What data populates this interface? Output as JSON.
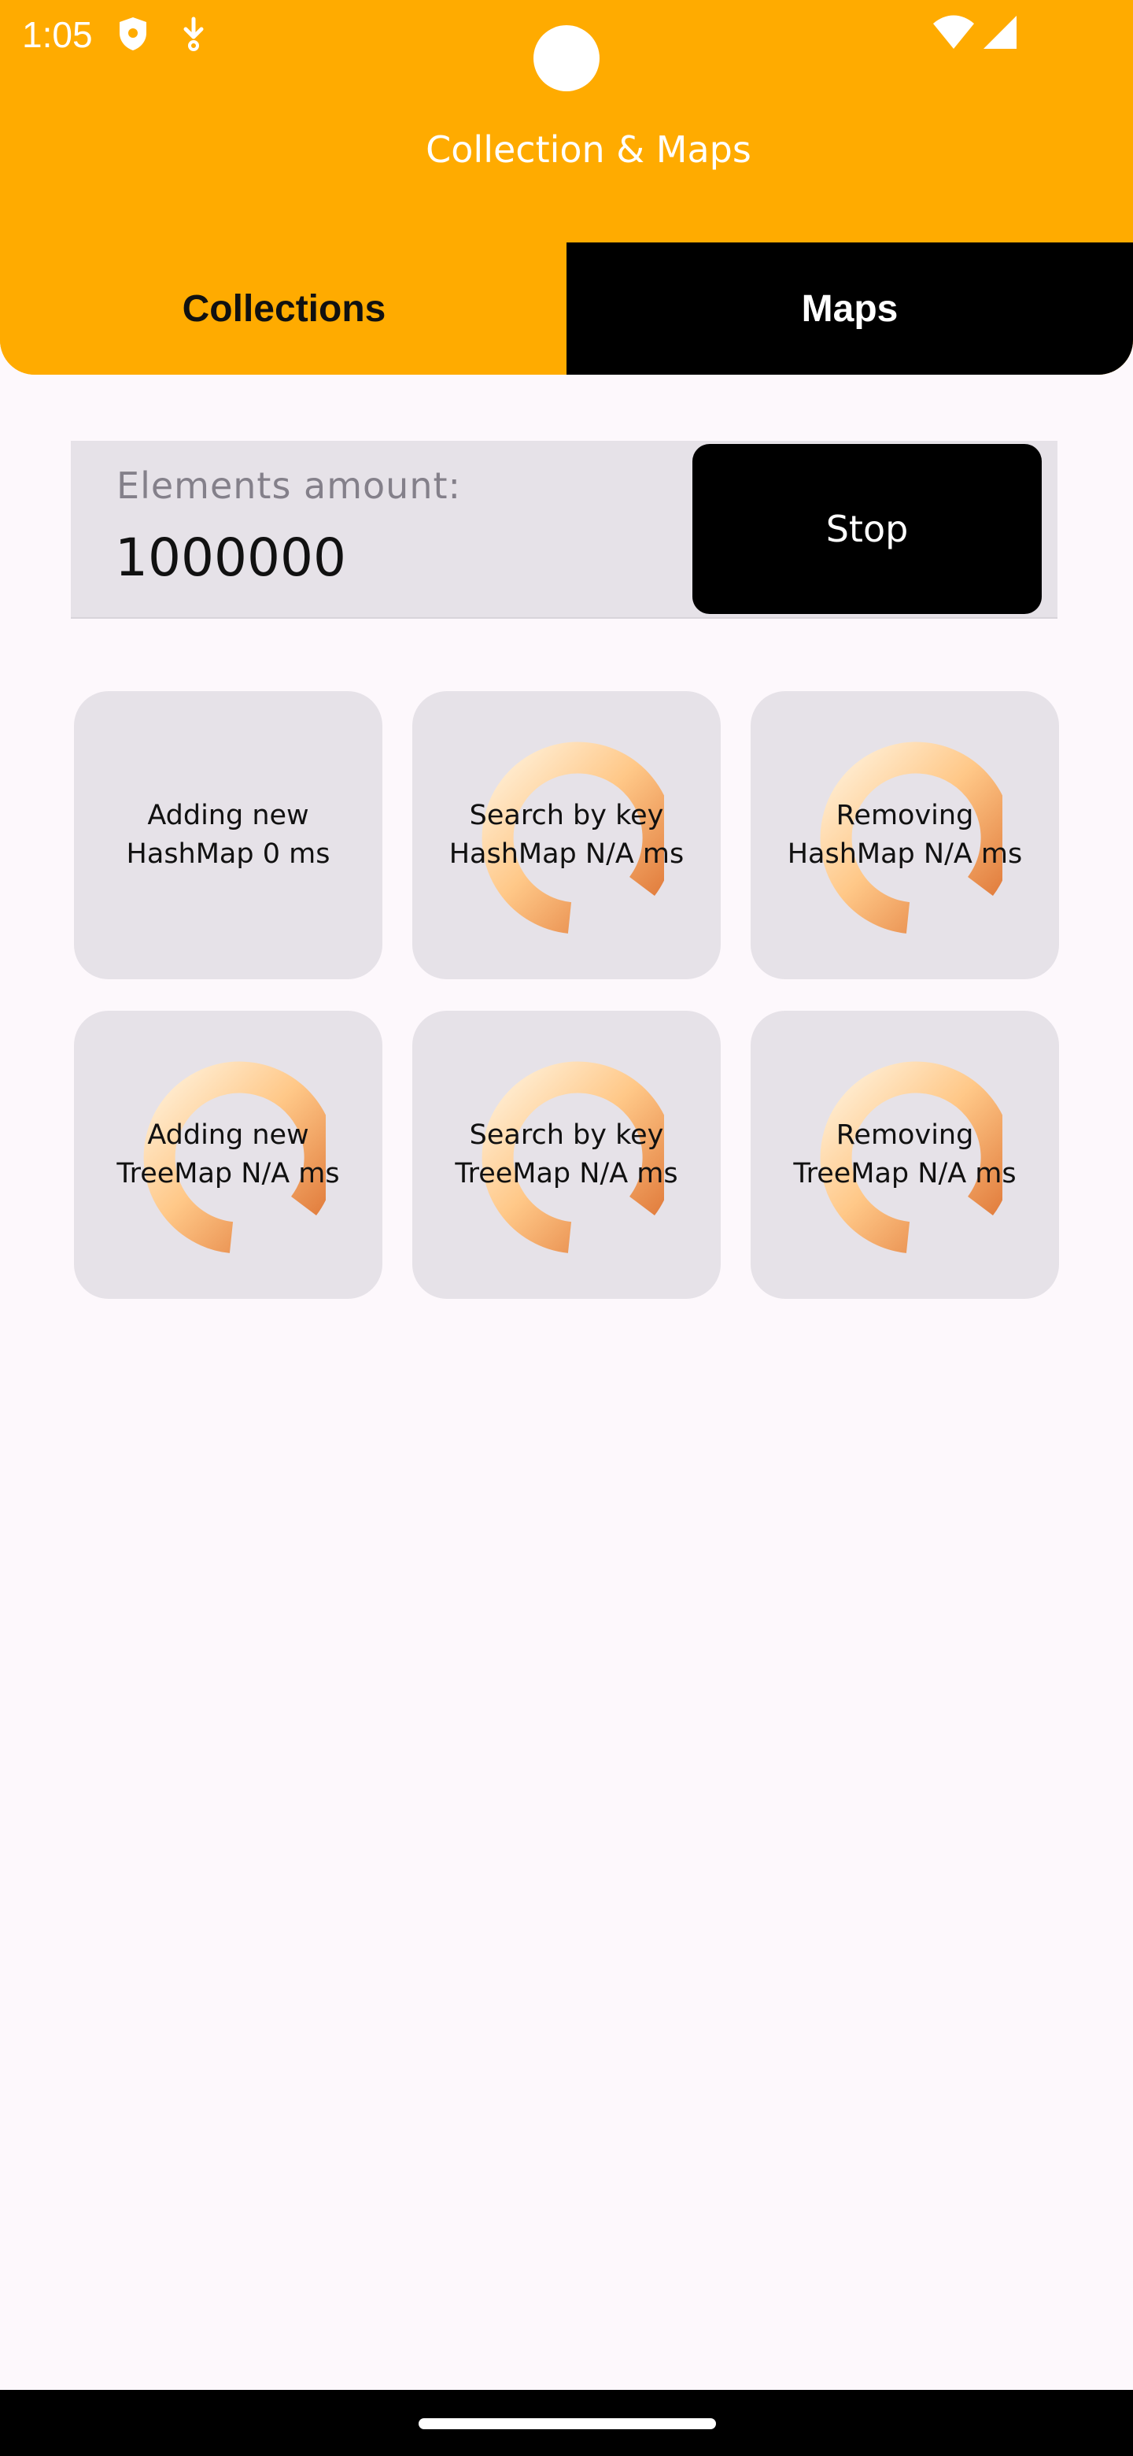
{
  "status_bar": {
    "time": "1:05",
    "icons": [
      "shield-icon",
      "download-icon",
      "wifi-icon",
      "signal-icon"
    ]
  },
  "header": {
    "title": "Collection & Maps",
    "background_color": "#ffab00"
  },
  "tabs": [
    {
      "label": "Collections",
      "selected": false
    },
    {
      "label": "Maps",
      "selected": true
    }
  ],
  "elements_input": {
    "label": "Elements amount:",
    "value": "1000000"
  },
  "stop_button": {
    "label": "Stop"
  },
  "cards": [
    {
      "text": "Adding new\nHashMap 0 ms",
      "loading": false
    },
    {
      "text": "Search by key\nHashMap N/A ms",
      "loading": true
    },
    {
      "text": "Removing\nHashMap N/A ms",
      "loading": true
    },
    {
      "text": "Adding new\nTreeMap N/A ms",
      "loading": true
    },
    {
      "text": "Search by key\nTreeMap N/A ms",
      "loading": true
    },
    {
      "text": "Removing\nTreeMap N/A ms",
      "loading": true
    }
  ],
  "colors": {
    "accent": "#ffab00",
    "card_background": "#e6e2e8",
    "spinner_light": "#ffd8a0",
    "spinner_dark": "#e0793a"
  }
}
